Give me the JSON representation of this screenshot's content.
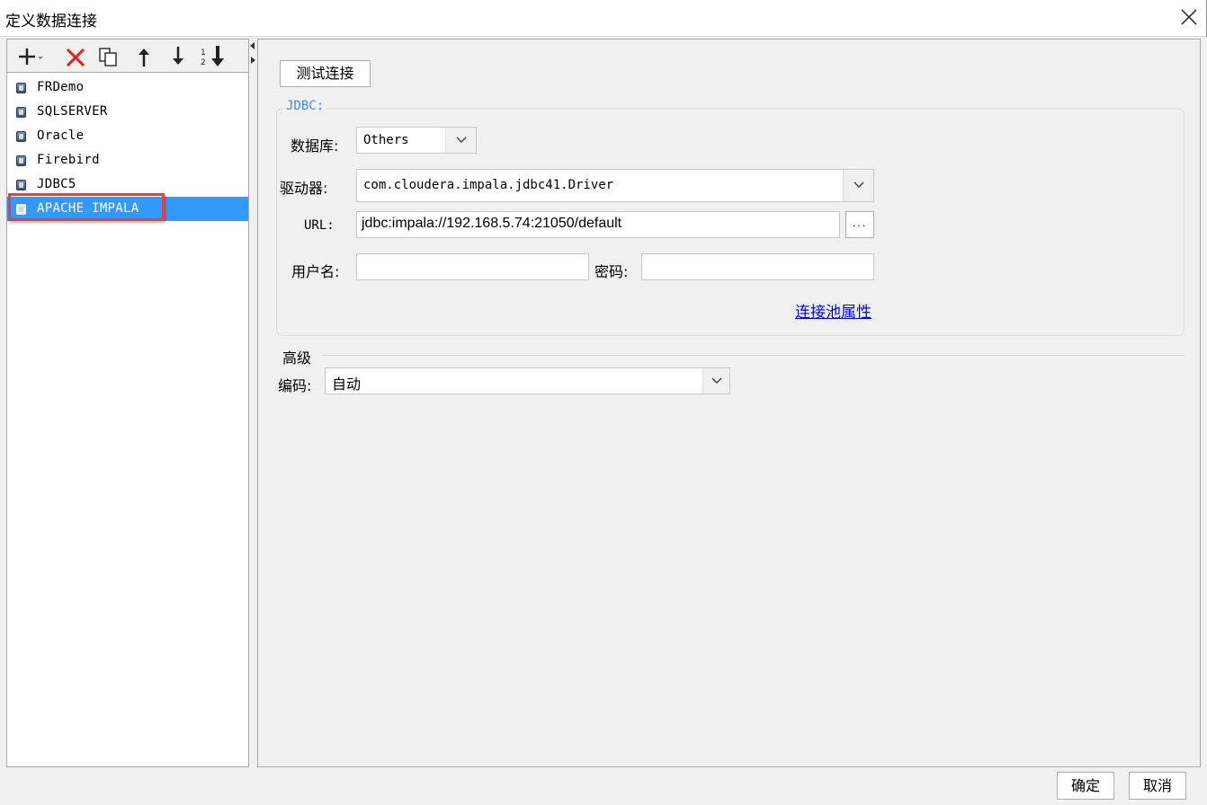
{
  "window": {
    "title": "定义数据连接"
  },
  "toolbar": {
    "icons": [
      "add-icon",
      "delete-icon",
      "copy-icon",
      "move-up-icon",
      "move-down-icon",
      "sort-icon"
    ]
  },
  "connections": [
    {
      "label": "FRDemo",
      "selected": false
    },
    {
      "label": "SQLSERVER",
      "selected": false
    },
    {
      "label": "Oracle",
      "selected": false
    },
    {
      "label": "Firebird",
      "selected": false
    },
    {
      "label": "JDBC5",
      "selected": false
    },
    {
      "label": "APACHE IMPALA",
      "selected": true
    }
  ],
  "main": {
    "test_connection_label": "测试连接",
    "jdbc_legend": "JDBC:",
    "database_label": "数据库:",
    "database_value": "Others",
    "driver_label": "驱动器:",
    "driver_value": "com.cloudera.impala.jdbc41.Driver",
    "url_label": "URL:",
    "url_value": "jdbc:impala://192.168.5.74:21050/default",
    "url_browse_label": "...",
    "username_label": "用户名:",
    "username_value": "",
    "password_label": "密码:",
    "password_value": "",
    "pool_link": "连接池属性",
    "advanced_label": "高级",
    "encoding_label": "编码:",
    "encoding_value": "自动"
  },
  "footer": {
    "ok_label": "确定",
    "cancel_label": "取消"
  },
  "colors": {
    "selection": "#3399ff",
    "highlight_border": "#e04343",
    "legend": "#3a8ee6",
    "link": "#0000ee"
  }
}
